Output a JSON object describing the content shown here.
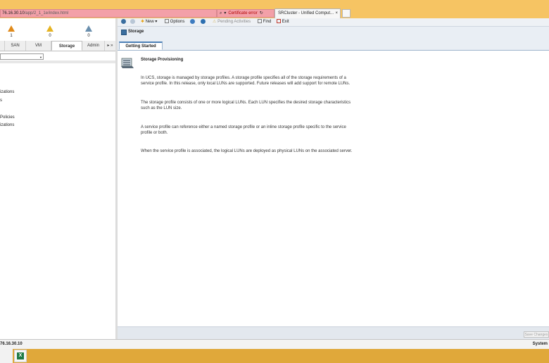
{
  "browser": {
    "address_host": "76.16.30.10",
    "address_path": "/app/2_1_1e/index.html",
    "search_glyph": "⌕",
    "dropdown_glyph": "▾",
    "cert_error_label": "Certificate error",
    "refresh_glyph": "↻",
    "tab_title": "SRCluster - Unified Comput...",
    "tab_close": "×"
  },
  "faults": [
    {
      "count": "1",
      "color": "#e08a1a"
    },
    {
      "count": "0",
      "color": "#e6b422"
    },
    {
      "count": "0",
      "color": "#6a8fae"
    }
  ],
  "nav_tabs": [
    {
      "label": ""
    },
    {
      "label": "SAN"
    },
    {
      "label": "VM"
    },
    {
      "label": "Storage"
    },
    {
      "label": "Admin"
    },
    {
      "label": "▸ »"
    }
  ],
  "tree_items": [
    {
      "label": "izations"
    },
    {
      "label": "s"
    },
    {
      "label": "Policies"
    },
    {
      "label": "izations"
    }
  ],
  "toolbar": {
    "new_label": "New ▾",
    "options_label": "Options",
    "pending_label": "Pending Activities",
    "find_label": "Find",
    "exit_label": "Exit"
  },
  "page": {
    "title": "Storage",
    "tab_label": "Getting Started",
    "section_title": "Storage Provisioning",
    "paragraphs": [
      "In UCS, storage is managed by storage profiles. A storage profile specifies all of the storage requirements of a service profile. In this release, only local LUNs are supported. Future releases will add support for remote LUNs.",
      "The storage profile consists of one or more logical LUNs. Each LUN specifies the desired storage characteristics such as the LUN size.",
      "A service profile can reference either a named storage profile or an inline storage profile specific to the service profile or both.",
      "When the service profile is associated, the logical LUNs are deployed as physical LUNs on the associated server."
    ],
    "save_changes_label": "Save Changes"
  },
  "status": {
    "ip": "76.16.30.10",
    "system": "System"
  },
  "taskbar": {
    "excel_glyph": "X"
  },
  "colors": {
    "browser_bar": "#f6c463",
    "address_error": "#f3a0a8",
    "accent_tab": "#4b7fb6",
    "taskbar": "#e0a83a"
  }
}
